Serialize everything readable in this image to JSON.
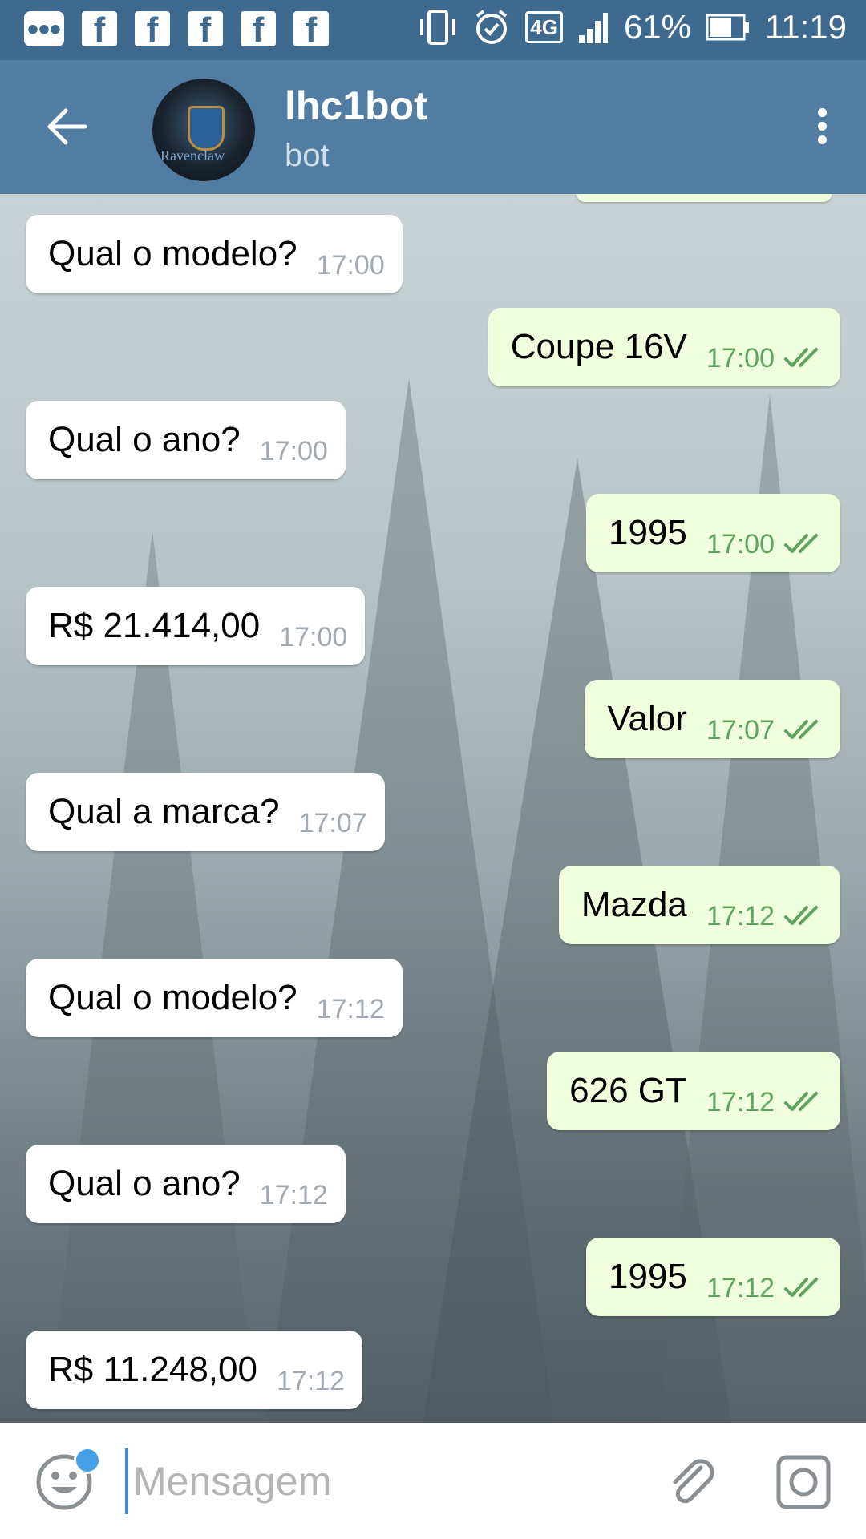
{
  "status_bar": {
    "notification_icons": [
      "message-icon",
      "facebook-icon",
      "facebook-icon",
      "facebook-icon",
      "facebook-icon",
      "facebook-icon"
    ],
    "network": "4G",
    "battery": "61%",
    "time": "11:19"
  },
  "toolbar": {
    "title": "lhc1bot",
    "subtitle": "bot",
    "avatar_text": "Ravenclaw"
  },
  "messages": [
    {
      "dir": "in",
      "text": "Qual o modelo?",
      "time": "17:00"
    },
    {
      "dir": "out",
      "text": "Coupe 16V",
      "time": "17:00"
    },
    {
      "dir": "in",
      "text": "Qual o ano?",
      "time": "17:00"
    },
    {
      "dir": "out",
      "text": "1995",
      "time": "17:00"
    },
    {
      "dir": "in",
      "text": "R$ 21.414,00",
      "time": "17:00"
    },
    {
      "dir": "out",
      "text": "Valor",
      "time": "17:07"
    },
    {
      "dir": "in",
      "text": "Qual a marca?",
      "time": "17:07"
    },
    {
      "dir": "out",
      "text": "Mazda",
      "time": "17:12"
    },
    {
      "dir": "in",
      "text": "Qual o modelo?",
      "time": "17:12"
    },
    {
      "dir": "out",
      "text": "626 GT",
      "time": "17:12"
    },
    {
      "dir": "in",
      "text": "Qual o ano?",
      "time": "17:12"
    },
    {
      "dir": "out",
      "text": "1995",
      "time": "17:12"
    },
    {
      "dir": "in",
      "text": "R$ 11.248,00",
      "time": "17:12"
    }
  ],
  "composer": {
    "placeholder": "Mensagem"
  },
  "colors": {
    "status_bar": "#3f6a90",
    "toolbar": "#517da2",
    "incoming_bubble": "#ffffff",
    "outgoing_bubble": "#effedd",
    "outgoing_time": "#5fa35c",
    "incoming_time": "#a1aab3",
    "notification_dot": "#46a0e8"
  }
}
